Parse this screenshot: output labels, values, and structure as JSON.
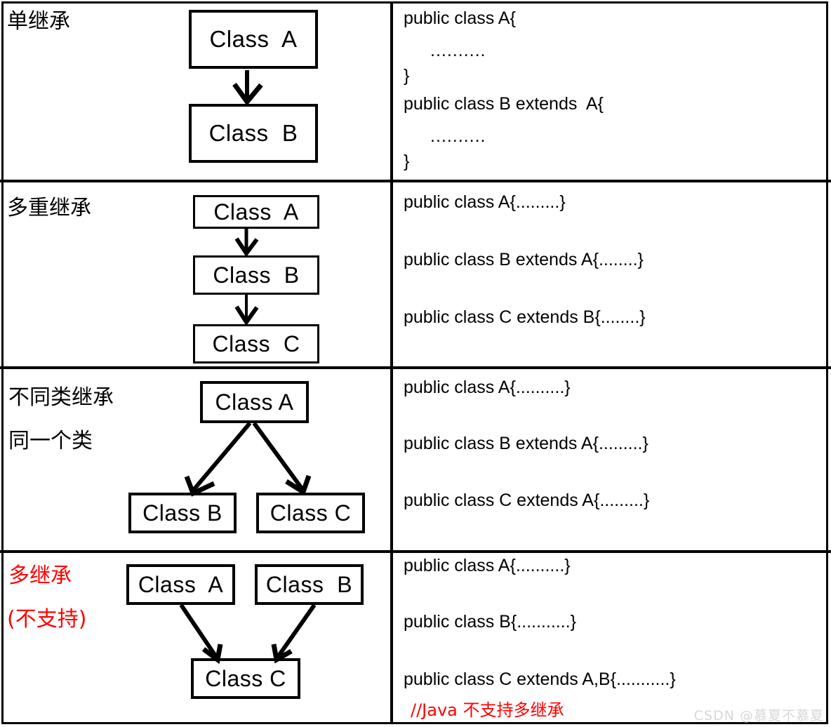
{
  "diagram": {
    "title_watermark": "CSDN @慕夏不慕夏",
    "colors": {
      "stroke": "#000000",
      "highlight": "#ff0000",
      "background": "#ffffff",
      "watermark": "#d8d8d8"
    },
    "rows": [
      {
        "id": "single-inheritance",
        "labels": [
          "单继承"
        ],
        "label_color": "#000000",
        "boxes": [
          {
            "name": "class-a",
            "text": "Class  A"
          },
          {
            "name": "class-b",
            "text": "Class  B"
          }
        ],
        "edges": [
          {
            "from": "Class A",
            "to": "Class B"
          }
        ],
        "code": [
          {
            "text": "public class A{",
            "indent": false,
            "red": false
          },
          {
            "text": "..........",
            "indent": true,
            "red": false
          },
          {
            "text": "}",
            "indent": false,
            "red": false
          },
          {
            "text": "public class B extends  A{",
            "indent": false,
            "red": false
          },
          {
            "text": "..........",
            "indent": true,
            "red": false
          },
          {
            "text": "}",
            "indent": false,
            "red": false
          }
        ]
      },
      {
        "id": "multilevel-inheritance",
        "labels": [
          "多重继承"
        ],
        "label_color": "#000000",
        "boxes": [
          {
            "name": "class-a",
            "text": "Class  A"
          },
          {
            "name": "class-b",
            "text": "Class  B"
          },
          {
            "name": "class-c",
            "text": "Class  C"
          }
        ],
        "edges": [
          {
            "from": "Class A",
            "to": "Class B"
          },
          {
            "from": "Class B",
            "to": "Class C"
          }
        ],
        "code": [
          {
            "text": "public class A{.........}",
            "indent": false,
            "red": false
          },
          {
            "text": "public class B extends A{........}",
            "indent": false,
            "red": false
          },
          {
            "text": "public class C extends B{........}",
            "indent": false,
            "red": false
          }
        ]
      },
      {
        "id": "hierarchical-inheritance",
        "labels": [
          "不同类继承",
          "同一个类"
        ],
        "label_color": "#000000",
        "boxes": [
          {
            "name": "class-a",
            "text": "Class A"
          },
          {
            "name": "class-b",
            "text": "Class B"
          },
          {
            "name": "class-c",
            "text": "Class C"
          }
        ],
        "edges": [
          {
            "from": "Class A",
            "to": "Class B"
          },
          {
            "from": "Class A",
            "to": "Class C"
          }
        ],
        "code": [
          {
            "text": "public class A{..........}",
            "indent": false,
            "red": false
          },
          {
            "text": "public class B extends A{.........}",
            "indent": false,
            "red": false
          },
          {
            "text": "public class C extends A{.........}",
            "indent": false,
            "red": false
          }
        ]
      },
      {
        "id": "multiple-inheritance",
        "labels": [
          "多继承",
          "(不支持)"
        ],
        "label_color": "#ff0000",
        "boxes": [
          {
            "name": "class-a",
            "text": "Class  A"
          },
          {
            "name": "class-b",
            "text": "Class  B"
          },
          {
            "name": "class-c",
            "text": "Class C"
          }
        ],
        "edges": [
          {
            "from": "Class A",
            "to": "Class C"
          },
          {
            "from": "Class B",
            "to": "Class C"
          }
        ],
        "code": [
          {
            "text": "public class A{..........}",
            "indent": false,
            "red": false
          },
          {
            "text": "public class B{...........}",
            "indent": false,
            "red": false
          },
          {
            "text": "public class C extends A,B{...........}",
            "indent": false,
            "red": false
          },
          {
            "text": "//Java 不支持多继承",
            "indent": false,
            "red": true
          }
        ]
      }
    ]
  }
}
